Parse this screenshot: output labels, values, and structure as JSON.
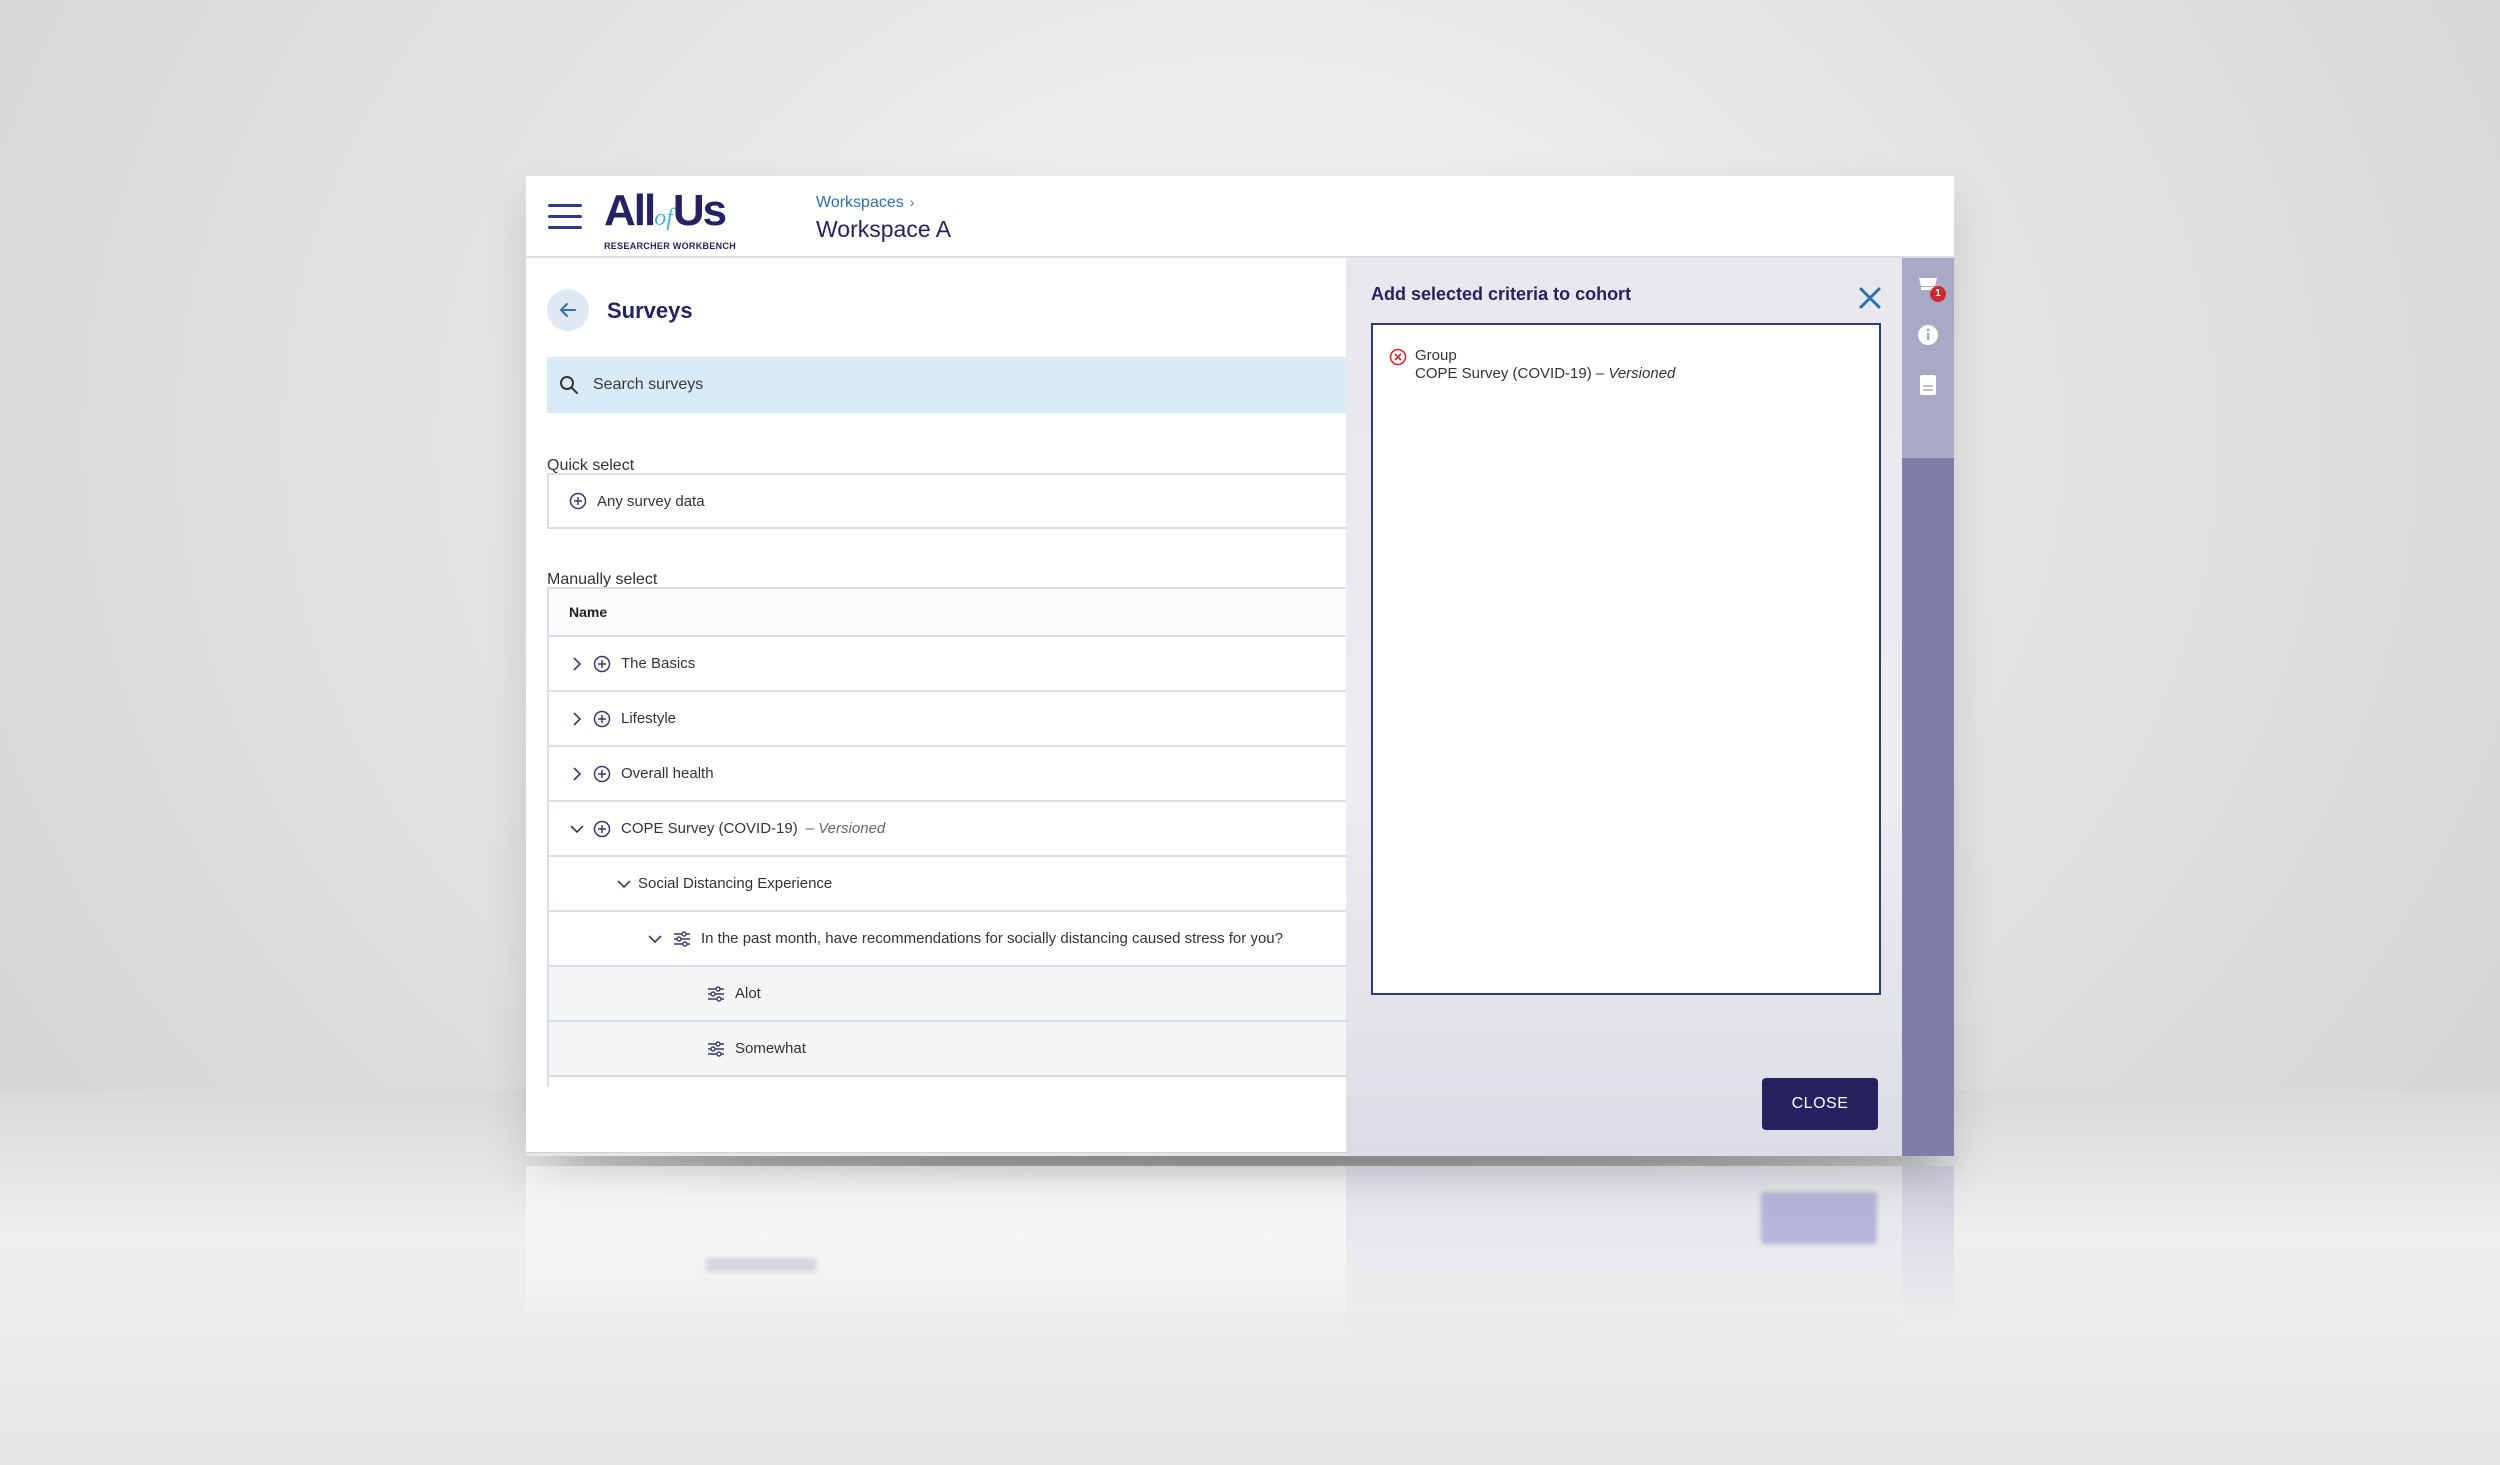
{
  "header": {
    "logo_main_left": "All",
    "logo_main_of": "of",
    "logo_main_right": "Us",
    "logo_sub": "RESEARCHER WORKBENCH",
    "breadcrumb_link": "Workspaces",
    "breadcrumb_sep": "›",
    "workspace_title": "Workspace A"
  },
  "page": {
    "title": "Surveys",
    "search_placeholder": "Search surveys",
    "quick_select_label": "Quick select",
    "quick_select_item": "Any survey data",
    "manual_select_label": "Manually select",
    "table_header": "Name",
    "rows": [
      {
        "label": "The Basics"
      },
      {
        "label": "Lifestyle"
      },
      {
        "label": "Overall health"
      },
      {
        "label": "COPE Survey (COVID-19)",
        "note": "– Versioned"
      },
      {
        "label": "Social Distancing Experience"
      },
      {
        "label": "In the past month, have recommendations for socially distancing caused stress for you?"
      },
      {
        "label": "Alot"
      },
      {
        "label": "Somewhat"
      }
    ]
  },
  "drawer": {
    "title": "Add selected criteria to cohort",
    "criteria": [
      {
        "group": "Group",
        "name": "COPE Survey (COVID-19) – ",
        "version": "Versioned"
      }
    ],
    "close_label": "CLOSE"
  },
  "rail": {
    "badge_count": "1"
  },
  "colors": {
    "brand_navy": "#262262",
    "link_blue": "#2e6fb0",
    "search_bg": "#d9eaf8",
    "rail": "#7e7ea6",
    "badge_red": "#d0282a"
  }
}
